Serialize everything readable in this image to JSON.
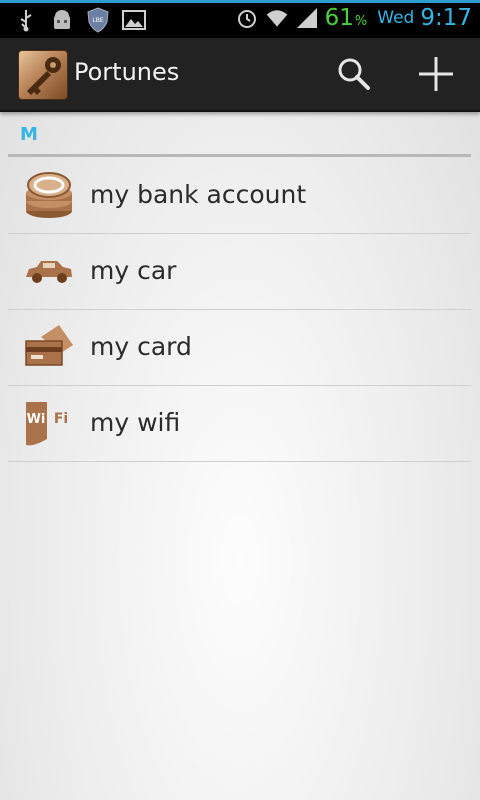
{
  "status_bar": {
    "battery_value": "61",
    "battery_unit": "%",
    "day": "Wed",
    "time": "9:17",
    "icons": [
      "usb-icon",
      "android-debug-icon",
      "shield-icon",
      "image-icon",
      "alarm-icon",
      "wifi-icon",
      "signal-icon"
    ]
  },
  "action_bar": {
    "title": "Portunes",
    "icons": [
      "app-key-icon",
      "search-icon",
      "add-icon"
    ]
  },
  "list": {
    "section_header": "M",
    "items": [
      {
        "label": "my bank account",
        "icon": "coins-icon"
      },
      {
        "label": "my car",
        "icon": "car-icon"
      },
      {
        "label": "my card",
        "icon": "credit-card-icon"
      },
      {
        "label": "my wifi",
        "icon": "wifi-logo-icon",
        "icon_text": "Wi Fi"
      }
    ]
  },
  "colors": {
    "accent": "#33b5e5",
    "battery": "#4ccf3e",
    "action_bar": "#222222",
    "icon_brown": "#a9724a"
  }
}
